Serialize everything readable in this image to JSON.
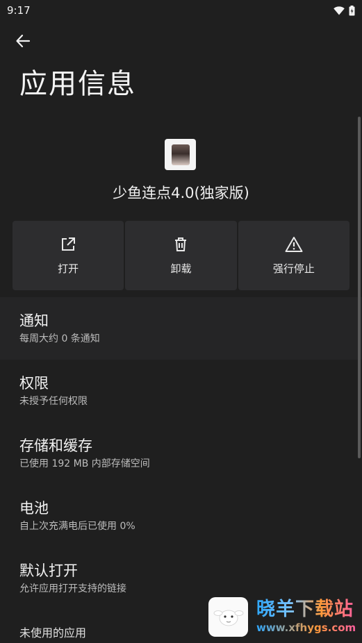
{
  "status_bar": {
    "time": "9:17"
  },
  "header": {
    "title": "应用信息"
  },
  "app": {
    "name": "少鱼连点4.0(独家版)"
  },
  "actions": [
    {
      "label": "打开",
      "icon": "open-external-icon"
    },
    {
      "label": "卸载",
      "icon": "trash-icon"
    },
    {
      "label": "强行停止",
      "icon": "warning-icon"
    }
  ],
  "list": [
    {
      "title": "通知",
      "subtitle": "每周大约 0 条通知"
    },
    {
      "title": "权限",
      "subtitle": "未授予任何权限"
    },
    {
      "title": "存储和缓存",
      "subtitle": "已使用 192 MB 内部存储空间"
    },
    {
      "title": "电池",
      "subtitle": "自上次充满电后已使用 0%"
    },
    {
      "title": "默认打开",
      "subtitle": "允许应用打开支持的链接"
    },
    {
      "title": "未使用的应用",
      "subtitle": ""
    }
  ],
  "watermark": {
    "title": "晓羊下载站",
    "url": "www.xfhygs.com"
  }
}
